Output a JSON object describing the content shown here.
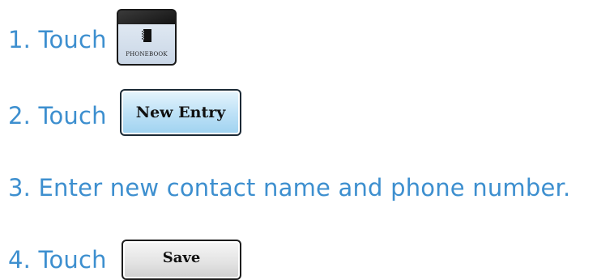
{
  "steps": [
    {
      "text": "1. Touch"
    },
    {
      "text": "2. Touch"
    },
    {
      "text": "3. Enter new contact name and phone number."
    },
    {
      "text": "4. Touch"
    }
  ],
  "phonebook_icon": {
    "caption": "PHONEBOOK",
    "icon": "address-book-icon"
  },
  "new_entry_button": {
    "label": "New Entry"
  },
  "save_button": {
    "label": "Save"
  },
  "colors": {
    "step_text": "#3d8fcf",
    "new_entry_bg": "#bfe2f7",
    "save_bg": "#e2e2e2"
  }
}
